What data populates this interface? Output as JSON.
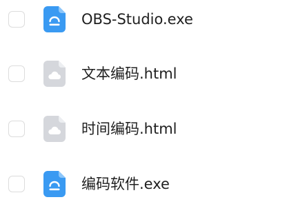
{
  "files": [
    {
      "name": "OBS-Studio.exe",
      "icon": "exe-file-icon",
      "checked": false
    },
    {
      "name": "文本编码.html",
      "icon": "html-cloud-file-icon",
      "checked": false
    },
    {
      "name": "时间编码.html",
      "icon": "html-cloud-file-icon",
      "checked": false
    },
    {
      "name": "编码软件.exe",
      "icon": "exe-file-icon",
      "checked": false
    }
  ],
  "colors": {
    "exe_icon": "#3a9af2",
    "exe_icon_fold": "#8cc6fa",
    "html_icon": "#d5d7dc",
    "html_icon_fold": "#eceef1",
    "checkbox_border": "#dcdcdc",
    "text": "#1f1f1f"
  }
}
